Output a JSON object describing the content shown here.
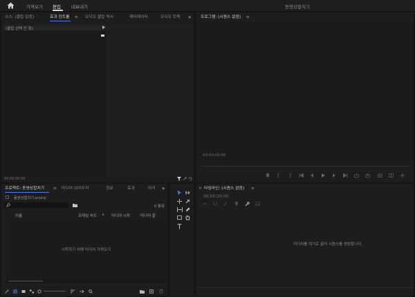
{
  "topbar": {
    "nav": [
      "가져오기",
      "편집",
      "내보내기"
    ],
    "active_index": 1,
    "title": "동영상합치기"
  },
  "source_panel": {
    "tabs": [
      "소스: (클립 없음)",
      "효과 컨트롤",
      "≡",
      "오디오 클립 믹서",
      "메타데이터",
      "오디오 트랙"
    ],
    "active_tab": 1,
    "more": "»",
    "clip_label": "(클립 선택 안 됨)",
    "timecode": "00;00;00;00"
  },
  "program_panel": {
    "tab": "프로그램: (시퀀스 없음)",
    "menu": "≡",
    "timecode": "00;00;00;00"
  },
  "project_panel": {
    "tabs": [
      "프로젝트: 동영상합치기",
      "≡",
      "미디어 브라우저",
      "정보",
      "효과",
      "마커"
    ],
    "more": "»",
    "file_name": "동영상합치기.prproj",
    "search_placeholder": "",
    "item_count": "0 항목",
    "columns": [
      "이름",
      "프레임 속도",
      "∧",
      "미디어 시작",
      "미디어 끝"
    ],
    "empty_message": "시작하기 위해 미디어 가져오기"
  },
  "timeline_panel": {
    "close": "×",
    "tab": "타임라인: (시퀀스 없음)",
    "menu": "≡",
    "timecode": "00;00;00;00",
    "empty_message": "미디어를 여기로 끌어 시퀀스를 생성합니다."
  },
  "colors": {
    "accent": "#4e7ff0",
    "panel_bg": "#1d1d1d",
    "frame_bg": "#161616",
    "topbar_bg": "#1e1e1e"
  }
}
